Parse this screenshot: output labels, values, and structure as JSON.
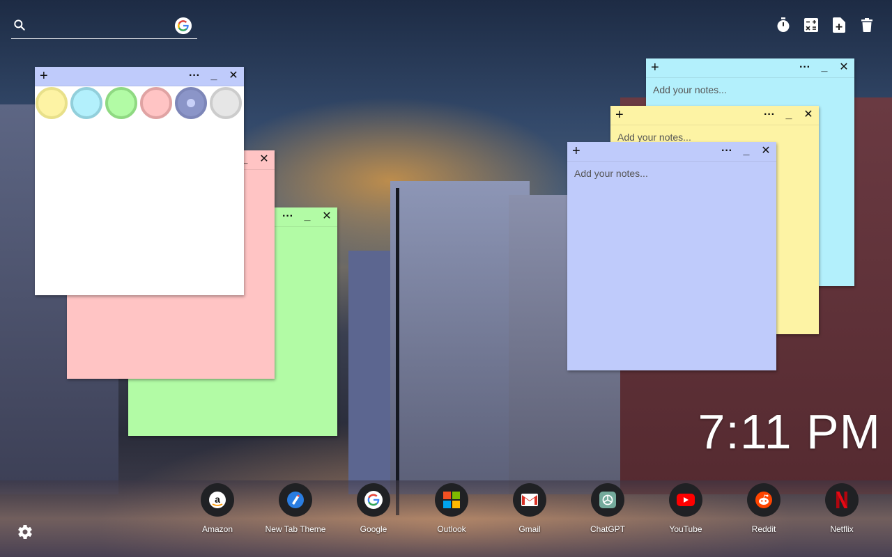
{
  "search": {
    "placeholder": ""
  },
  "tools": [
    {
      "icon": "timer-icon"
    },
    {
      "icon": "calculator-icon"
    },
    {
      "icon": "new-note-icon"
    },
    {
      "icon": "trash-icon"
    }
  ],
  "colors": {
    "yellow": "#fdf3a4",
    "cyan": "#b3f0fc",
    "green": "#b2fba5",
    "pink": "#ffc4c4",
    "lavender": "#bfcbfb",
    "white": "#ffffff",
    "light": "#e6e6e6"
  },
  "notes": {
    "white": {
      "plus": "+",
      "more": "···",
      "min": "_",
      "close": "✕"
    },
    "pink": {
      "min": "_",
      "close": "✕"
    },
    "green": {
      "more": "···",
      "min": "_",
      "close": "✕"
    },
    "cyan": {
      "plus": "+",
      "more": "···",
      "min": "_",
      "close": "✕",
      "placeholder": "Add your notes..."
    },
    "yellow": {
      "plus": "+",
      "more": "···",
      "min": "_",
      "close": "✕",
      "placeholder": "Add your notes..."
    },
    "lavender": {
      "plus": "+",
      "more": "···",
      "min": "_",
      "close": "✕",
      "placeholder": "Add your notes..."
    }
  },
  "palette": [
    "yellow",
    "cyan",
    "green",
    "pink",
    "lavender",
    "light"
  ],
  "clock": "7:11 PM",
  "dock": [
    {
      "label": "Amazon",
      "icon": "amazon-icon"
    },
    {
      "label": "New Tab Theme",
      "icon": "new-tab-theme-icon"
    },
    {
      "label": "Google",
      "icon": "google-icon"
    },
    {
      "label": "Outlook",
      "icon": "outlook-icon"
    },
    {
      "label": "Gmail",
      "icon": "gmail-icon"
    },
    {
      "label": "ChatGPT",
      "icon": "chatgpt-icon"
    },
    {
      "label": "YouTube",
      "icon": "youtube-icon"
    },
    {
      "label": "Reddit",
      "icon": "reddit-icon"
    },
    {
      "label": "Netflix",
      "icon": "netflix-icon"
    }
  ]
}
